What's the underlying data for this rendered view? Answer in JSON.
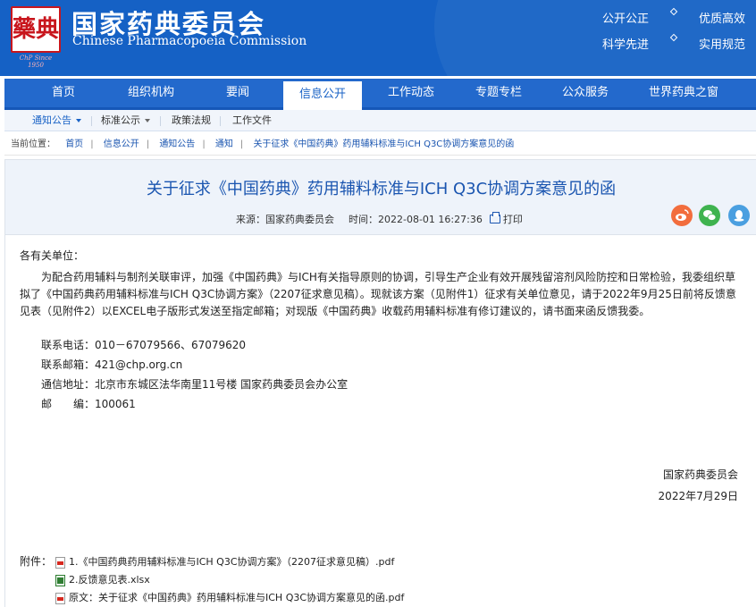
{
  "header": {
    "logo_glyph": "藥典",
    "logo_since": "ChP Since 1950",
    "org_name_cn": "国家药典委员会",
    "org_name_en": "Chinese Pharmacopoeia Commission",
    "slogans": [
      "公开公正",
      "优质高效",
      "科学先进",
      "实用规范"
    ]
  },
  "nav": {
    "items": [
      "首页",
      "组织机构",
      "要闻",
      "信息公开",
      "工作动态",
      "专题专栏",
      "公众服务",
      "世界药典之窗"
    ],
    "active": "信息公开"
  },
  "subnav": {
    "items": [
      "通知公告",
      "标准公示",
      "政策法规",
      "工作文件"
    ]
  },
  "breadcrumb": {
    "prefix": "当前位置：",
    "items": [
      "首页",
      "信息公开",
      "通知公告",
      "通知",
      "关于征求《中国药典》药用辅料标准与ICH Q3C协调方案意见的函"
    ]
  },
  "article": {
    "title": "关于征求《中国药典》药用辅料标准与ICH Q3C协调方案意见的函",
    "source_label": "来源：",
    "source": "国家药典委员会",
    "time_label": "时间：",
    "time": "2022-08-01 16:27:36",
    "print_label": "打印",
    "greeting": "各有关单位：",
    "paragraph": "为配合药用辅料与制剂关联审评，加强《中国药典》与ICH有关指导原则的协调，引导生产企业有效开展残留溶剂风险防控和日常检验，我委组织草拟了《中国药典药用辅料标准与ICH Q3C协调方案》（2207征求意见稿）。现就该方案（见附件1）征求有关单位意见，请于2022年9月25日前将反馈意见表（见附件2）以EXCEL电子版形式发送至指定邮箱；对现版《中国药典》收载药用辅料标准有修订建议的，请书面来函反馈我委。",
    "contacts": [
      "联系电话：010－67079566、67079620",
      "联系邮箱：421@chp.org.cn",
      "通信地址：北京市东城区法华南里11号楼 国家药典委员会办公室",
      "邮　　编：100061"
    ],
    "signature": "国家药典委员会",
    "date": "2022年7月29日",
    "attachments_label": "附件：",
    "attachments": [
      {
        "name": "1.《中国药典药用辅料标准与ICH Q3C协调方案》（2207征求意见稿）.pdf",
        "icon": "pdf-icon"
      },
      {
        "name": "2.反馈意见表.xlsx",
        "icon": "excel-icon"
      },
      {
        "name": "原文：关于征求《中国药典》药用辅料标准与ICH Q3C协调方案意见的函.pdf",
        "icon": "pdf-icon"
      }
    ]
  },
  "share": {
    "icons": [
      "weibo-icon",
      "wechat-icon",
      "qq-icon"
    ],
    "colors": [
      "#f26d3d",
      "#3fb34f",
      "#4a9fe0"
    ]
  },
  "colors": {
    "brand_blue": "#1561c5",
    "nav_blue": "#2369cc",
    "title_blue": "#1a55b0",
    "seal_red": "#c8161d"
  }
}
